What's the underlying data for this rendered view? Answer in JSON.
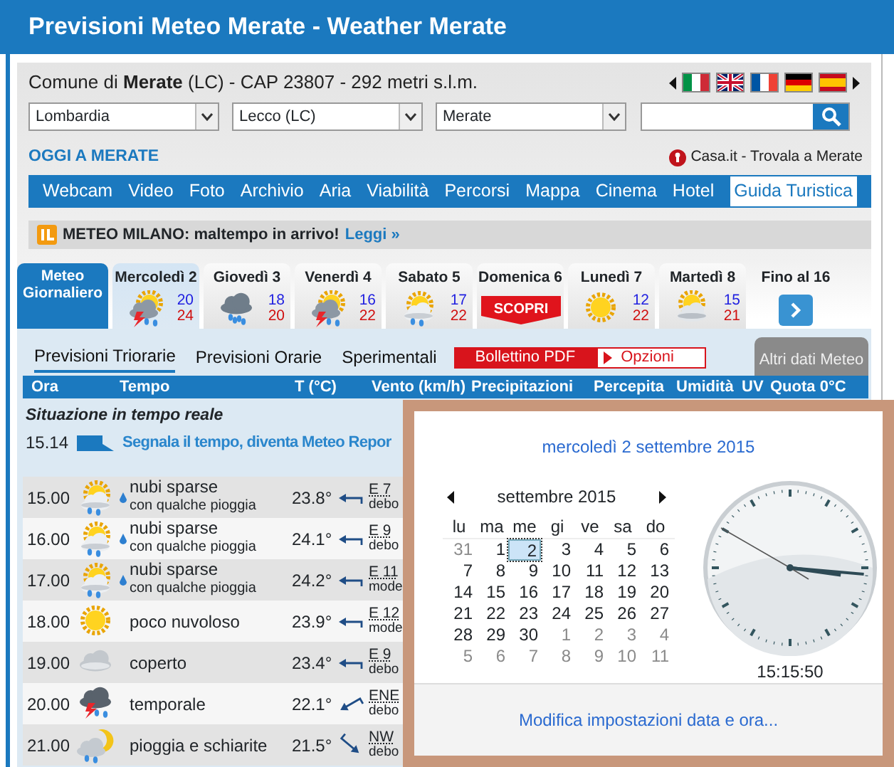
{
  "header": {
    "title": "Previsioni Meteo Merate - Weather Merate"
  },
  "location": {
    "text": "Comune di **Merate** (LC) - CAP 23807 - 292 metri s.l.m."
  },
  "languages": [
    {
      "kind": "it"
    },
    {
      "kind": "en"
    },
    {
      "kind": "fr"
    },
    {
      "kind": "de"
    },
    {
      "kind": "es"
    }
  ],
  "selects": [
    {
      "value": "Lombardia"
    },
    {
      "value": "Lecco (LC)"
    },
    {
      "value": "Merate"
    }
  ],
  "today_link": "OGGI A MERATE",
  "promo": "Casa.it - Trovala a Merate",
  "nav": [
    {
      "label": "Webcam",
      "selected": false
    },
    {
      "label": "Video",
      "selected": false
    },
    {
      "label": "Foto",
      "selected": false
    },
    {
      "label": "Archivio",
      "selected": false
    },
    {
      "label": "Aria",
      "selected": false
    },
    {
      "label": "Viabilità",
      "selected": false
    },
    {
      "label": "Percorsi",
      "selected": false
    },
    {
      "label": "Mappa",
      "selected": false
    },
    {
      "label": "Cinema",
      "selected": false
    },
    {
      "label": "Hotel",
      "selected": false
    },
    {
      "label": "Guida Turistica",
      "selected": true
    }
  ],
  "alert": {
    "text": "METEO MILANO: maltempo in arrivo!",
    "link": "Leggi »"
  },
  "main_tab": {
    "label": "Meteo Giornaliero"
  },
  "days": [
    {
      "label": "Mercoledì 2",
      "kind": "storm-sun",
      "min": "20",
      "max": "24",
      "selected": true
    },
    {
      "label": "Giovedì 3",
      "kind": "rain",
      "min": "18",
      "max": "20",
      "selected": false
    },
    {
      "label": "Venerdì 4",
      "kind": "storm-sun",
      "min": "16",
      "max": "22",
      "selected": false
    },
    {
      "label": "Sabato 5",
      "kind": "sun-cloud-rain",
      "min": "17",
      "max": "22",
      "selected": false
    },
    {
      "label": "Domenica 6",
      "kind": "badge",
      "badge": "SCOPRI",
      "selected": false
    },
    {
      "label": "Lunedì 7",
      "kind": "sun",
      "min": "12",
      "max": "22",
      "selected": false
    },
    {
      "label": "Martedì 8",
      "kind": "sun-cloud",
      "min": "15",
      "max": "21",
      "selected": false
    }
  ],
  "more": {
    "label": "Fino al 16"
  },
  "subtabs": [
    {
      "label": "Previsioni Triorarie",
      "selected": true
    },
    {
      "label": "Previsioni Orarie",
      "selected": false
    },
    {
      "label": "Sperimentali",
      "selected": false
    }
  ],
  "pdf_button": "Bollettino PDF",
  "options_button": "Opzioni",
  "side_tab": "Altri dati Meteo",
  "table": {
    "columns": [
      "Ora",
      "Tempo",
      "T (°C)",
      "Vento (km/h)",
      "Precipitazioni",
      "Percepita",
      "Umidità",
      "UV",
      "Quota 0°C"
    ],
    "realtime_label": "Situazione in tempo reale",
    "report": {
      "time": "15.14",
      "text": "Segnala il tempo, diventa Meteo Repor"
    },
    "rows": [
      {
        "time": "15.00",
        "kind": "sun-cloud-rain",
        "drop": true,
        "desc": "nubi sparse",
        "subdesc": "con qualche pioggia",
        "temp": "23.8°",
        "wind": {
          "kind": "left",
          "speed": "E 7",
          "strength": "debo"
        }
      },
      {
        "time": "16.00",
        "kind": "sun-cloud-rain",
        "drop": true,
        "desc": "nubi sparse",
        "subdesc": "con qualche pioggia",
        "temp": "24.1°",
        "wind": {
          "kind": "left",
          "speed": "E 9",
          "strength": "debo"
        }
      },
      {
        "time": "17.00",
        "kind": "sun-cloud-rain",
        "drop": true,
        "desc": "nubi sparse",
        "subdesc": "con qualche pioggia",
        "temp": "24.2°",
        "wind": {
          "kind": "left",
          "speed": "E 11",
          "strength": "mode"
        }
      },
      {
        "time": "18.00",
        "kind": "sun",
        "drop": false,
        "desc": "poco nuvoloso",
        "temp": "23.9°",
        "wind": {
          "kind": "left",
          "speed": "E 12",
          "strength": "mode"
        }
      },
      {
        "time": "19.00",
        "kind": "cloud",
        "drop": false,
        "desc": "coperto",
        "temp": "23.4°",
        "wind": {
          "kind": "left",
          "speed": "E 9",
          "strength": "debo"
        }
      },
      {
        "time": "20.00",
        "kind": "storm",
        "drop": false,
        "desc": "temporale",
        "temp": "22.1°",
        "wind": {
          "kind": "down-left",
          "speed": "ENE",
          "strength": "debo"
        }
      },
      {
        "time": "21.00",
        "kind": "moon-rain",
        "drop": false,
        "desc": "pioggia e schiarite",
        "temp": "21.5°",
        "wind": {
          "kind": "down-right",
          "speed": "NW",
          "strength": "debo"
        }
      }
    ]
  },
  "popup": {
    "date_title": "mercoledì 2 settembre 2015",
    "month": "settembre 2015",
    "weekdays": [
      "lu",
      "ma",
      "me",
      "gi",
      "ve",
      "sa",
      "do"
    ],
    "weeks": [
      [
        {
          "label": "31",
          "other_month": true,
          "selected": false
        },
        {
          "label": "1",
          "other_month": false,
          "selected": false
        },
        {
          "label": "2",
          "other_month": false,
          "selected": true
        },
        {
          "label": "3",
          "other_month": false,
          "selected": false
        },
        {
          "label": "4",
          "other_month": false,
          "selected": false
        },
        {
          "label": "5",
          "other_month": false,
          "selected": false
        },
        {
          "label": "6",
          "other_month": false,
          "selected": false
        }
      ],
      [
        {
          "label": "7",
          "other_month": false,
          "selected": false
        },
        {
          "label": "8",
          "other_month": false,
          "selected": false
        },
        {
          "label": "9",
          "other_month": false,
          "selected": false
        },
        {
          "label": "10",
          "other_month": false,
          "selected": false
        },
        {
          "label": "11",
          "other_month": false,
          "selected": false
        },
        {
          "label": "12",
          "other_month": false,
          "selected": false
        },
        {
          "label": "13",
          "other_month": false,
          "selected": false
        }
      ],
      [
        {
          "label": "14",
          "other_month": false,
          "selected": false
        },
        {
          "label": "15",
          "other_month": false,
          "selected": false
        },
        {
          "label": "16",
          "other_month": false,
          "selected": false
        },
        {
          "label": "17",
          "other_month": false,
          "selected": false
        },
        {
          "label": "18",
          "other_month": false,
          "selected": false
        },
        {
          "label": "19",
          "other_month": false,
          "selected": false
        },
        {
          "label": "20",
          "other_month": false,
          "selected": false
        }
      ],
      [
        {
          "label": "21",
          "other_month": false,
          "selected": false
        },
        {
          "label": "22",
          "other_month": false,
          "selected": false
        },
        {
          "label": "23",
          "other_month": false,
          "selected": false
        },
        {
          "label": "24",
          "other_month": false,
          "selected": false
        },
        {
          "label": "25",
          "other_month": false,
          "selected": false
        },
        {
          "label": "26",
          "other_month": false,
          "selected": false
        },
        {
          "label": "27",
          "other_month": false,
          "selected": false
        }
      ],
      [
        {
          "label": "28",
          "other_month": false,
          "selected": false
        },
        {
          "label": "29",
          "other_month": false,
          "selected": false
        },
        {
          "label": "30",
          "other_month": false,
          "selected": false
        },
        {
          "label": "1",
          "other_month": true,
          "selected": false
        },
        {
          "label": "2",
          "other_month": true,
          "selected": false
        },
        {
          "label": "3",
          "other_month": true,
          "selected": false
        },
        {
          "label": "4",
          "other_month": true,
          "selected": false
        }
      ],
      [
        {
          "label": "5",
          "other_month": true,
          "selected": false
        },
        {
          "label": "6",
          "other_month": true,
          "selected": false
        },
        {
          "label": "7",
          "other_month": true,
          "selected": false
        },
        {
          "label": "8",
          "other_month": true,
          "selected": false
        },
        {
          "label": "9",
          "other_month": true,
          "selected": false
        },
        {
          "label": "10",
          "other_month": true,
          "selected": false
        },
        {
          "label": "11",
          "other_month": true,
          "selected": false
        }
      ]
    ],
    "time": "15:15:50",
    "link": "Modifica impostazioni data e ora..."
  }
}
